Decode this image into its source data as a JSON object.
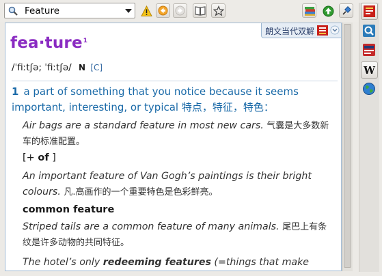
{
  "search": {
    "value": "Feature"
  },
  "icons": {
    "search": "magnifier-icon",
    "warning": "warning-icon",
    "back": "back-arrow-icon",
    "forward": "forward-arrow-icon",
    "book": "book-icon",
    "favorite": "star-icon",
    "dictionaries": "books-icon",
    "go": "go-up-icon",
    "pin": "pin-icon"
  },
  "dictionary_tab": {
    "name": "朗文当代双解"
  },
  "entry": {
    "headword": "fea·ture",
    "homograph": "1",
    "pronunciation": "/ˈfiːtʃə; ˈfiːtʃə/",
    "pos": "N",
    "grammar": "[C]",
    "sense": {
      "number": "1",
      "definition": "a part of something that you notice because it seems important, interesting, or typical 特点，特征，特色："
    },
    "examples": [
      {
        "en": "Air bags are a standard feature in most new cars.",
        "zh": "气囊是大多数新车的标准配置。"
      },
      {
        "en": "An important feature of Van Gogh’s paintings is their bright colours.",
        "zh": "凡.高画作的一个重要特色是色彩鲜亮。"
      },
      {
        "en": "Striped tails are a common feature of many animals.",
        "zh": "尾巴上有条纹是许多动物的共同特征。"
      }
    ],
    "grammar_pattern": {
      "open": "[+ ",
      "word": "of",
      "close": " ]"
    },
    "collocation": "common feature",
    "partial_example": {
      "before": "The hotel’s only ",
      "bold": "redeeming features",
      "after": " (=things that make"
    }
  },
  "colors": {
    "headword": "#8a2bc2",
    "definition": "#1a6aa8",
    "panel_border": "#9eb8d2"
  }
}
